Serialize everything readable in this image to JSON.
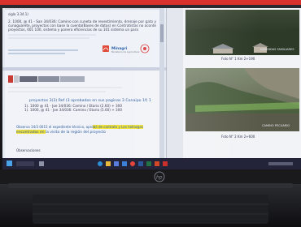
{
  "scene": {
    "description_hidden": false
  },
  "left_document": {
    "header_label": "sigla 3.34.1)",
    "line1": "2.  1000, @ 41 - San 34/036: Camino con cuneta de revestimiento, drenaje por gato y",
    "line2": "cunaguarete, proyectos con base la cuenta(Bases de datos) en Contratistas no aconte",
    "line3": "proyectos, 001 100, sistema y ponera eficiencias de su 101 sistema un para",
    "logo_name": "Minagri",
    "logo_sub": "Ministerio de Agricultura",
    "list_item1": "proyectos 3(3) Ref (3 aprobados en sus paginas 3 Conaipo 1f) 1",
    "list_item2": "1).  1000 @ 41 - Joe 34/036: Camino / Etario (2.60) + 300",
    "list_item3": "1).  1000, @ 41 - Joe 34/036: Camino / Etario (5.60) + 300",
    "highlight_para": "Observa 34/3 0015 el expediente técnico, aprobó de contrato y Los hallazgos",
    "highlight_para2": "encontrados en la visita de la región del proyecto",
    "footer_label": "Observaciones"
  },
  "right_document": {
    "photo1_caption": "Foto N° 1  Km 2+190",
    "photo1_overlay": "VIVIENDAS FAMILIARES",
    "photo2_caption": "Foto N° 2  Km 2+600",
    "photo2_overlay": "CAMINO PECUARIO"
  },
  "taskbar": {
    "icons": [
      "windows-icon",
      "search-icon",
      "task-view-icon",
      "edge-icon",
      "folder-icon",
      "store-icon",
      "mail-icon",
      "chrome-icon",
      "word-icon",
      "excel-icon",
      "powerpoint-icon",
      "pdf-icon"
    ]
  },
  "laptop": {
    "brand": "hp"
  },
  "colors": {
    "screen_border_red": "#e02a26",
    "taskbar": "#23233a",
    "highlight": "#f2e33a",
    "word_blue": "#2b579a"
  }
}
